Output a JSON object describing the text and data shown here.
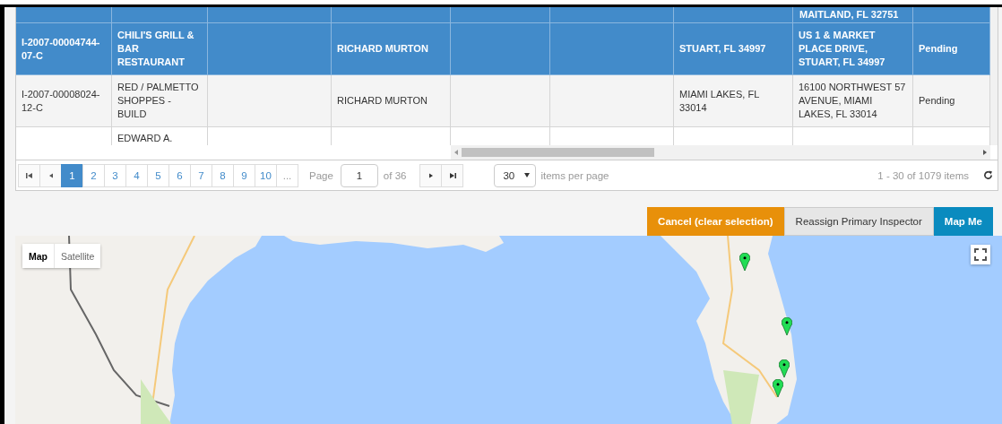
{
  "table": {
    "rows": [
      {
        "selected": true,
        "column_8": "MAITLAND, FL 32751"
      },
      {
        "selected": true,
        "column_1": "I-2007-00004744-07-C",
        "column_2": "CHILI'S GRILL & BAR RESTAURANT",
        "column_4": "RICHARD MURTON",
        "column_7": "STUART, FL 34997",
        "column_8": "US 1 & MARKET PLACE DRIVE, STUART, FL 34997",
        "column_9": "Pending"
      },
      {
        "selected": false,
        "column_1": "I-2007-00008024-12-C",
        "column_2": "RED / PALMETTO SHOPPES - BUILD",
        "column_4": "RICHARD MURTON",
        "column_7": "MIAMI LAKES, FL 33014",
        "column_8": "16100 NORTHWEST 57 AVENUE, MIAMI LAKES, FL 33014",
        "column_9": "Pending"
      },
      {
        "selected": false,
        "column_2": "EDWARD A."
      }
    ]
  },
  "pager": {
    "pages": [
      {
        "label": "1",
        "selected": true
      },
      {
        "label": "2",
        "selected": false
      },
      {
        "label": "3",
        "selected": false
      },
      {
        "label": "4",
        "selected": false
      },
      {
        "label": "5",
        "selected": false
      },
      {
        "label": "6",
        "selected": false
      },
      {
        "label": "7",
        "selected": false
      },
      {
        "label": "8",
        "selected": false
      },
      {
        "label": "9",
        "selected": false
      },
      {
        "label": "10",
        "selected": false
      }
    ],
    "more": "...",
    "page_label": "Page",
    "page_value": "1",
    "of_pages": "of 36",
    "page_size": "30",
    "page_size_label": "items per page",
    "summary": "1 - 30 of 1079 items"
  },
  "actions": [
    {
      "label": "Cancel (clear selection)",
      "kind": "warning"
    },
    {
      "label": "Reassign Primary Inspector",
      "kind": "default"
    },
    {
      "label": "Map Me",
      "kind": "primary"
    }
  ],
  "map": {
    "map_types": [
      {
        "label": "Map",
        "selected": true
      },
      {
        "label": "Satellite",
        "selected": false
      }
    ]
  }
}
